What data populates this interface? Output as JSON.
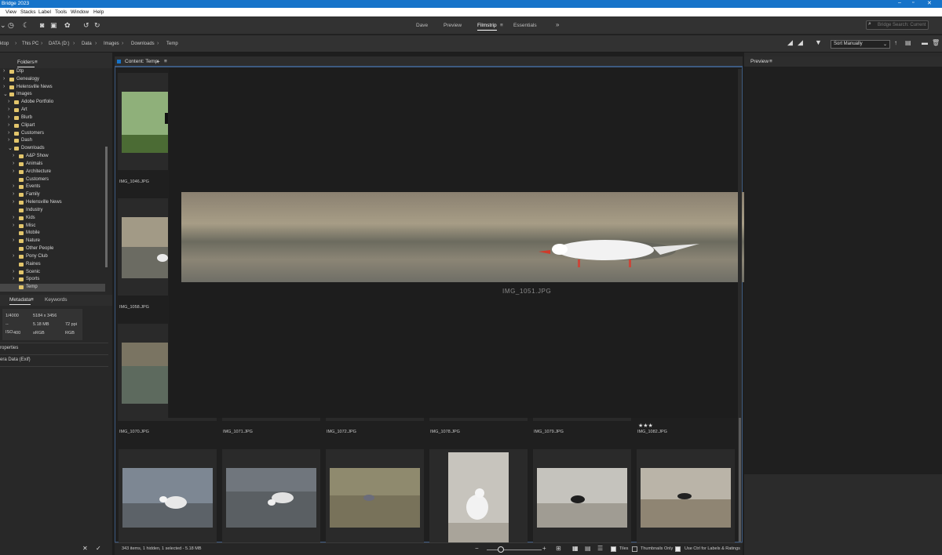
{
  "title": "Bridge 2023",
  "menu": [
    "View",
    "Stacks",
    "Label",
    "Tools",
    "Window",
    "Help"
  ],
  "workspaces": [
    "Dave",
    "Preview",
    "Filmstrip",
    "Essentials"
  ],
  "active_workspace": "Filmstrip",
  "search_placeholder": "Bridge Search: Current",
  "breadcrumb": [
    "ktop",
    "This PC",
    "DATA (D:)",
    "Data",
    "Images",
    "Downloads",
    "Temp"
  ],
  "sort": "Sort Manually",
  "panels": {
    "folders": "Folders",
    "content": "Content: Temp",
    "preview": "Preview",
    "metadata": "Metadata",
    "keywords": "Keywords"
  },
  "folders": [
    {
      "label": "Dtp",
      "depth": 0,
      "exp": false,
      "sel": false
    },
    {
      "label": "Genealogy",
      "depth": 0,
      "exp": false,
      "sel": false
    },
    {
      "label": "Helensville News",
      "depth": 0,
      "exp": false,
      "sel": false
    },
    {
      "label": "Images",
      "depth": 0,
      "exp": true,
      "sel": false
    },
    {
      "label": "Adobe Portfolio",
      "depth": 1,
      "exp": false,
      "sel": false
    },
    {
      "label": "Art",
      "depth": 1,
      "exp": false,
      "sel": false
    },
    {
      "label": "Blurb",
      "depth": 1,
      "exp": false,
      "sel": false
    },
    {
      "label": "Clipart",
      "depth": 1,
      "exp": false,
      "sel": false
    },
    {
      "label": "Customers",
      "depth": 1,
      "exp": false,
      "sel": false
    },
    {
      "label": "Dash",
      "depth": 1,
      "exp": false,
      "sel": false
    },
    {
      "label": "Downloads",
      "depth": 1,
      "exp": true,
      "sel": false
    },
    {
      "label": "A&P Show",
      "depth": 2,
      "exp": false,
      "sel": false
    },
    {
      "label": "Animals",
      "depth": 2,
      "exp": false,
      "sel": false
    },
    {
      "label": "Architecture",
      "depth": 2,
      "exp": false,
      "sel": false
    },
    {
      "label": "Customers",
      "depth": 2,
      "exp": null,
      "sel": false
    },
    {
      "label": "Events",
      "depth": 2,
      "exp": false,
      "sel": false
    },
    {
      "label": "Family",
      "depth": 2,
      "exp": false,
      "sel": false
    },
    {
      "label": "Helensville News",
      "depth": 2,
      "exp": false,
      "sel": false
    },
    {
      "label": "Industry",
      "depth": 2,
      "exp": null,
      "sel": false
    },
    {
      "label": "Kids",
      "depth": 2,
      "exp": false,
      "sel": false
    },
    {
      "label": "Misc",
      "depth": 2,
      "exp": false,
      "sel": false
    },
    {
      "label": "Mobile",
      "depth": 2,
      "exp": null,
      "sel": false
    },
    {
      "label": "Nature",
      "depth": 2,
      "exp": false,
      "sel": false
    },
    {
      "label": "Other People",
      "depth": 2,
      "exp": null,
      "sel": false
    },
    {
      "label": "Pony Club",
      "depth": 2,
      "exp": false,
      "sel": false
    },
    {
      "label": "Raines",
      "depth": 2,
      "exp": null,
      "sel": false
    },
    {
      "label": "Scenic",
      "depth": 2,
      "exp": false,
      "sel": false
    },
    {
      "label": "Sports",
      "depth": 2,
      "exp": false,
      "sel": false
    },
    {
      "label": "Temp",
      "depth": 2,
      "exp": null,
      "sel": true
    }
  ],
  "metadata": {
    "shutter": "1/4000",
    "aperture": "--",
    "iso_label": "ISO",
    "iso_value": "400",
    "dimensions": "5184 x 3456",
    "size": "5.18 MB",
    "ppi": "72 ppi",
    "colorspace": "sRGB",
    "mode": "RGB"
  },
  "sections": [
    "roperties",
    "era Data (Exif)"
  ],
  "left_col_files": [
    "IMG_1046.JPG",
    "IMG_1058.JPG"
  ],
  "preview_file": "IMG_1051.JPG",
  "row_files": [
    "IMG_1070.JPG",
    "IMG_1071.JPG",
    "IMG_1072.JPG",
    "IMG_1078.JPG",
    "IMG_1079.JPG",
    "IMG_1082.JPG"
  ],
  "rating_stars": "★★★",
  "status": {
    "text": "343 items, 1 hidden, 1 selected - 5.18 MB",
    "tiles": "Tiles",
    "thumbs_only": "Thumbnails Only",
    "ctrl_labels": "Use Ctrl for Labels & Ratings"
  },
  "colors": {
    "accent": "#1673c9",
    "folder": "#e2c56b",
    "content_border": "#3d5a80"
  }
}
